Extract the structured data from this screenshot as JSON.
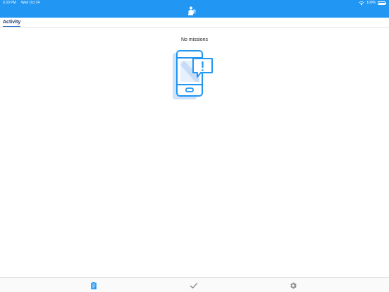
{
  "status_bar": {
    "time": "6:33 PM",
    "date": "Wed Oct 24",
    "battery": "100%"
  },
  "header": {
    "logo_icon": "person-at-desk-icon",
    "background_color": "#2196f3"
  },
  "tabs": [
    {
      "label": "Activity",
      "active": true
    }
  ],
  "main": {
    "empty_message": "No missions",
    "illustration_icon": "phone-notification-icon"
  },
  "bottom_nav": [
    {
      "icon": "clipboard-icon",
      "active": true
    },
    {
      "icon": "checkmark-icon",
      "active": false
    },
    {
      "icon": "gear-icon",
      "active": false
    }
  ]
}
